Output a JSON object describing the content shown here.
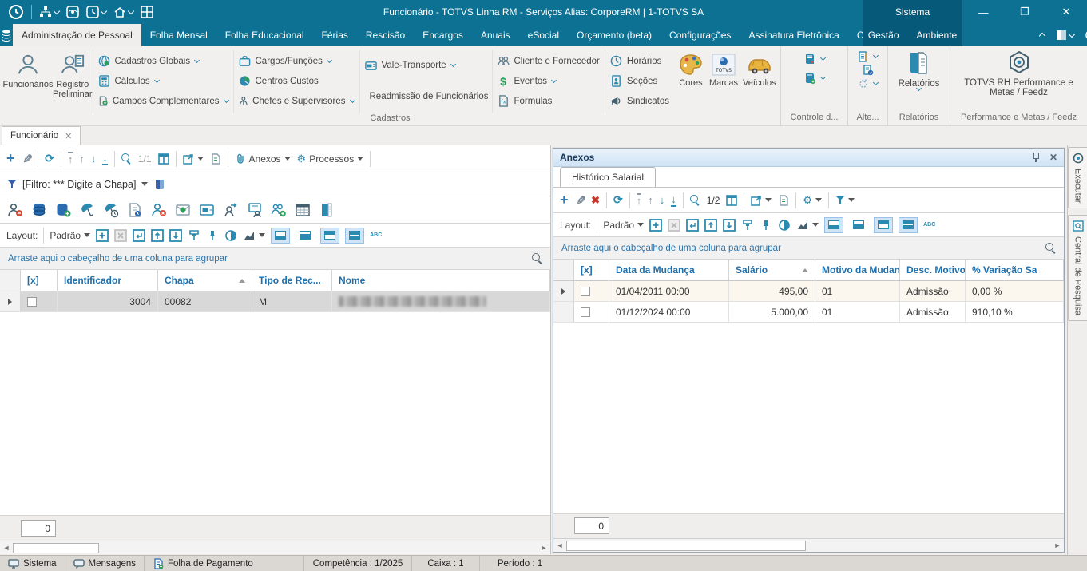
{
  "titlebar": {
    "title": "Funcionário - TOTVS Linha RM - Serviços  Alias: CorporeRM | 1-TOTVS SA",
    "system_label": "Sistema"
  },
  "ribbon_tabs": {
    "items": [
      "Administração de Pessoal",
      "Folha Mensal",
      "Folha Educacional",
      "Férias",
      "Rescisão",
      "Encargos",
      "Anuais",
      "eSocial",
      "Orçamento (beta)",
      "Configurações",
      "Assinatura Eletrônica",
      "Customização"
    ],
    "dark_items": [
      "Gestão",
      "Ambiente"
    ]
  },
  "ribbon": {
    "big_buttons": [
      {
        "label": "Funcionários"
      },
      {
        "label": "Registro Preliminar"
      }
    ],
    "items": {
      "cadastros_globais": "Cadastros Globais",
      "calculos": "Cálculos",
      "campos_complementares": "Campos Complementares",
      "cargos_funcoes": "Cargos/Funções",
      "centros_custos": "Centros Custos",
      "chefes_supervisores": "Chefes e Supervisores",
      "vale_transporte": "Vale-Transporte",
      "readmissao": "Readmissão de Funcionários",
      "cliente_fornecedor": "Cliente e Fornecedor",
      "eventos": "Eventos",
      "formulas": "Fórmulas",
      "horarios": "Horários",
      "secoes": "Seções",
      "sindicatos": "Sindicatos",
      "cores": "Cores",
      "marcas": "Marcas",
      "veiculos": "Veículos",
      "relatorios": "Relatórios",
      "performance": "TOTVS RH Performance e Metas / Feedz"
    },
    "group_labels": {
      "cadastros": "Cadastros",
      "controle": "Controle d...",
      "alteracoes": "Alte...",
      "relatorios": "Relatórios",
      "performance": "Performance e Metas / Feedz"
    }
  },
  "doc_tab": {
    "label": "Funcionário"
  },
  "left_panel": {
    "pager": "1/1",
    "anexos_button": "Anexos",
    "processos_button": "Processos",
    "filter_text": "[Filtro: *** Digite a Chapa]",
    "layout_label": "Layout:",
    "layout_value": "Padrão",
    "group_hint": "Arraste aqui o cabeçalho de uma coluna para agrupar",
    "table": {
      "headers": [
        "[x]",
        "Identificador",
        "Chapa",
        "Tipo de Rec...",
        "Nome"
      ],
      "rows": [
        {
          "identificador": "3004",
          "chapa": "00082",
          "tipo": "M"
        }
      ]
    },
    "count_value": "0"
  },
  "anexos_panel": {
    "title": "Anexos",
    "tab_label": "Histórico Salarial",
    "pager": "1/2",
    "layout_label": "Layout:",
    "layout_value": "Padrão",
    "group_hint": "Arraste aqui o cabeçalho de uma coluna para agrupar",
    "table": {
      "headers": [
        "[x]",
        "Data da Mudança",
        "Salário",
        "Motivo da Mudança",
        "Desc. Motivo",
        "% Variação Sa"
      ],
      "rows": [
        {
          "data_mudanca": "01/04/2011 00:00",
          "salario": "495,00",
          "motivo": "01",
          "desc_motivo": "Admissão",
          "variacao": "0,00 %"
        },
        {
          "data_mudanca": "01/12/2024 00:00",
          "salario": "5.000,00",
          "motivo": "01",
          "desc_motivo": "Admissão",
          "variacao": "910,10 %"
        }
      ]
    },
    "count_value": "0"
  },
  "side_tabs": {
    "executar": "Executar",
    "pesquisa": "Central de Pesquisa"
  },
  "statusbar": {
    "sistema": "Sistema",
    "mensagens": "Mensagens",
    "folha": "Folha de Pagamento",
    "competencia": "Competência : 1/2025",
    "caixa": "Caixa : 1",
    "periodo": "Período : 1"
  }
}
